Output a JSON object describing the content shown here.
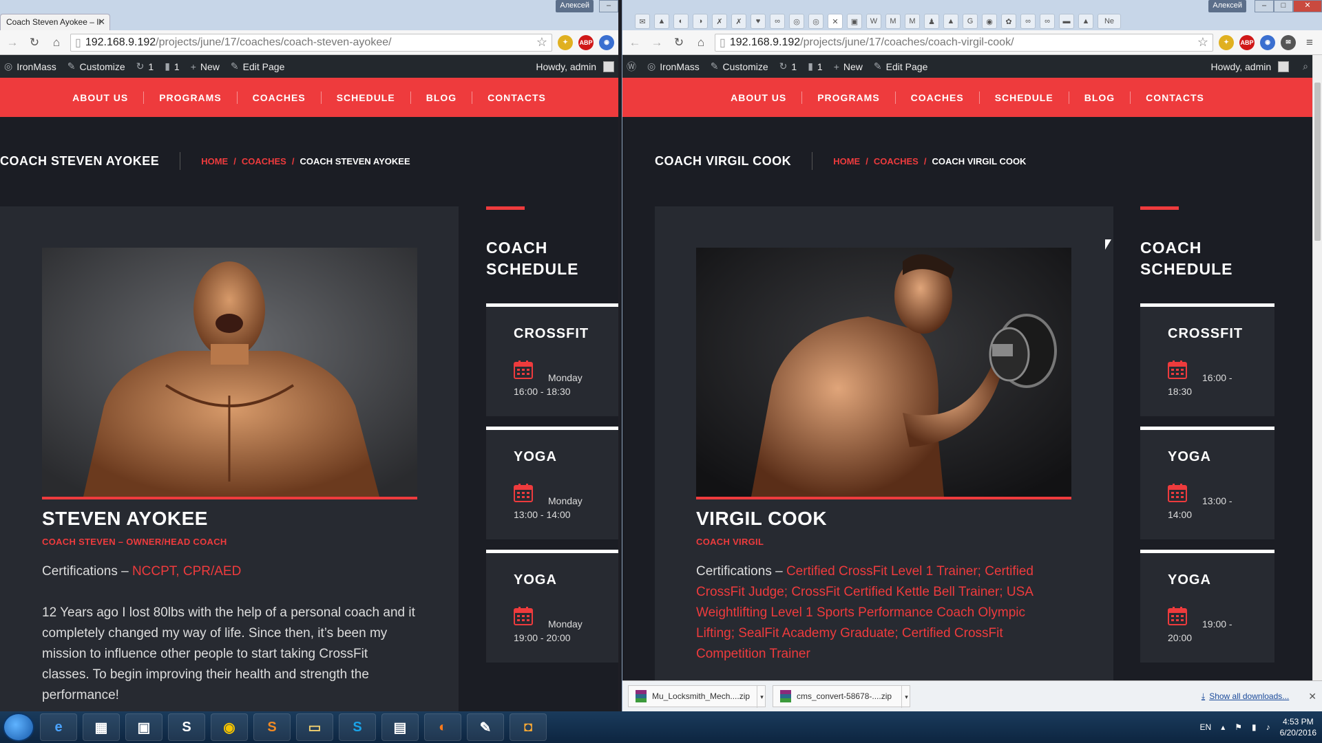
{
  "left_window": {
    "tab_title": "Coach Steven Ayokee – Ir",
    "url_host": "192.168.9.192",
    "url_path": "/projects/june/17/coaches/coach-steven-ayokee/",
    "window_user": "Алексей",
    "adminbar": {
      "site": "IronMass",
      "customize": "Customize",
      "updates": "1",
      "comments": "1",
      "new": "New",
      "edit": "Edit Page",
      "howdy": "Howdy, admin"
    },
    "nav": [
      "ABOUT US",
      "PROGRAMS",
      "COACHES",
      "SCHEDULE",
      "BLOG",
      "CONTACTS"
    ],
    "page_title": "COACH STEVEN AYOKEE",
    "breadcrumb": {
      "home": "HOME",
      "coaches": "COACHES",
      "sep": "/",
      "current": "COACH STEVEN AYOKEE"
    },
    "coach": {
      "name": "STEVEN AYOKEE",
      "role": "COACH STEVEN – OWNER/HEAD COACH",
      "cert_label": "Certifications –",
      "cert_value": "NCCPT, CPR/AED",
      "bio": "12 Years ago I lost 80lbs with the help of a personal coach and it completely changed my way of life. Since then, it’s been my mission to influence other people to start taking CrossFit classes. To begin improving their health and strength the performance!"
    },
    "schedule_title": "COACH SCHEDULE",
    "schedule": [
      {
        "name": "CROSSFIT",
        "day": "Monday",
        "time": "16:00 - 18:30"
      },
      {
        "name": "YOGA",
        "day": "Monday",
        "time": "13:00 - 14:00"
      },
      {
        "name": "YOGA",
        "day": "Monday",
        "time": "19:00 - 20:00"
      }
    ]
  },
  "right_window": {
    "url_host": "192.168.9.192",
    "url_path": "/projects/june/17/coaches/coach-virgil-cook/",
    "window_user": "Алексей",
    "tab_label": "Ne",
    "adminbar": {
      "site": "IronMass",
      "customize": "Customize",
      "updates": "1",
      "comments": "1",
      "new": "New",
      "edit": "Edit Page",
      "howdy": "Howdy, admin"
    },
    "nav": [
      "ABOUT US",
      "PROGRAMS",
      "COACHES",
      "SCHEDULE",
      "BLOG",
      "CONTACTS"
    ],
    "page_title": "COACH VIRGIL COOK",
    "breadcrumb": {
      "home": "HOME",
      "coaches": "COACHES",
      "sep": "/",
      "current": "COACH VIRGIL COOK"
    },
    "coach": {
      "name": "VIRGIL COOK",
      "role": "COACH VIRGIL",
      "cert_label": "Certifications –",
      "cert_value": "Certified CrossFit Level 1 Trainer; Certified CrossFit Judge; CrossFit Certified Kettle Bell Trainer; USA Weightlifting Level 1 Sports Performance Coach Olympic Lifting; SealFit Academy Graduate; Certified CrossFit Competition Trainer"
    },
    "schedule_title": "COACH SCHEDULE",
    "schedule": [
      {
        "name": "CROSSFIT",
        "time_a": "16:00 -",
        "time_b": "18:30"
      },
      {
        "name": "YOGA",
        "time_a": "13:00 -",
        "time_b": "14:00"
      },
      {
        "name": "YOGA",
        "time_a": "19:00 -",
        "time_b": "20:00"
      }
    ],
    "downloads": [
      {
        "name": "Mu_Locksmith_Mech....zip"
      },
      {
        "name": "cms_convert-58678-....zip"
      }
    ],
    "show_all": "Show all downloads..."
  },
  "taskbar": {
    "lang": "EN",
    "time": "4:53 PM",
    "date": "6/20/2016"
  },
  "colors": {
    "accent": "#ee3b3d",
    "bg": "#1b1d24",
    "panel": "#272a31",
    "adminbar": "#23282d"
  }
}
